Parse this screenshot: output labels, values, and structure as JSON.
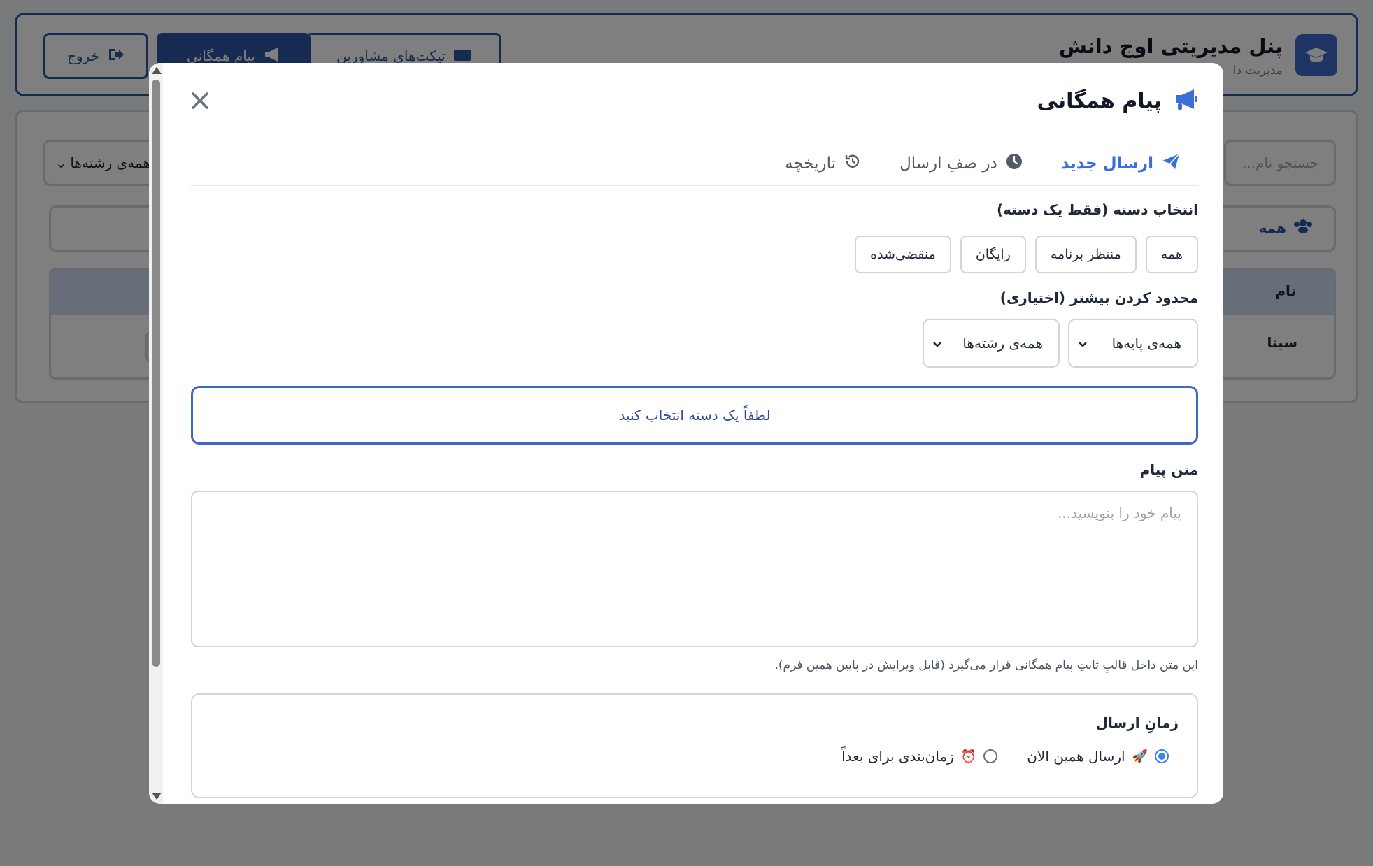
{
  "header": {
    "title": "پنل مدیریتی اوج دانش",
    "subtitle": "مدیریت دا",
    "logout_label": "خروج",
    "broadcast_label": "پیام همگانی",
    "tickets_label": "تیکت‌های مشاورین"
  },
  "background": {
    "search_placeholder": "جستجو نام...",
    "field_filter_value": "همه‌ی رشته‌ها",
    "group_filter_label": "همه",
    "table_header_name": "نام",
    "table_row_name": "سینا"
  },
  "modal": {
    "title": "پیام همگانی",
    "tabs": [
      {
        "label": "ارسال جدید",
        "icon": "paper-plane-icon",
        "active": true
      },
      {
        "label": "در صفِ ارسال",
        "icon": "clock-icon",
        "active": false
      },
      {
        "label": "تاریخچه",
        "icon": "history-icon",
        "active": false
      }
    ],
    "category_label": "انتخاب دسته (فقط یک دسته)",
    "categories": [
      "همه",
      "منتظر برنامه",
      "رایگان",
      "منقضی‌شده"
    ],
    "restrict_label": "محدود کردن بیشتر (اختیاری)",
    "grade_select_value": "همه‌ی پایه‌ها",
    "field_select_value": "همه‌ی رشته‌ها",
    "notice_text": "لطفاً یک دسته انتخاب کنید",
    "message_label": "متن پیام",
    "message_placeholder": "پیام خود را بنویسید...",
    "message_hint": "این متن داخل قالبِ ثابتِ پیام همگانی قرار می‌گیرد (قابل ویرایش در پایین همین فرم).",
    "timing_title": "زمانِ ارسال",
    "timing_options": [
      {
        "emoji": "🚀",
        "label": "ارسال همین الان",
        "checked": true
      },
      {
        "emoji": "⏰",
        "label": "زمان‌بندی برای بعداً",
        "checked": false
      }
    ]
  },
  "colors": {
    "accent": "#3b6fd8",
    "brand": "#2f55a4",
    "notice_text": "#2f48a8"
  }
}
